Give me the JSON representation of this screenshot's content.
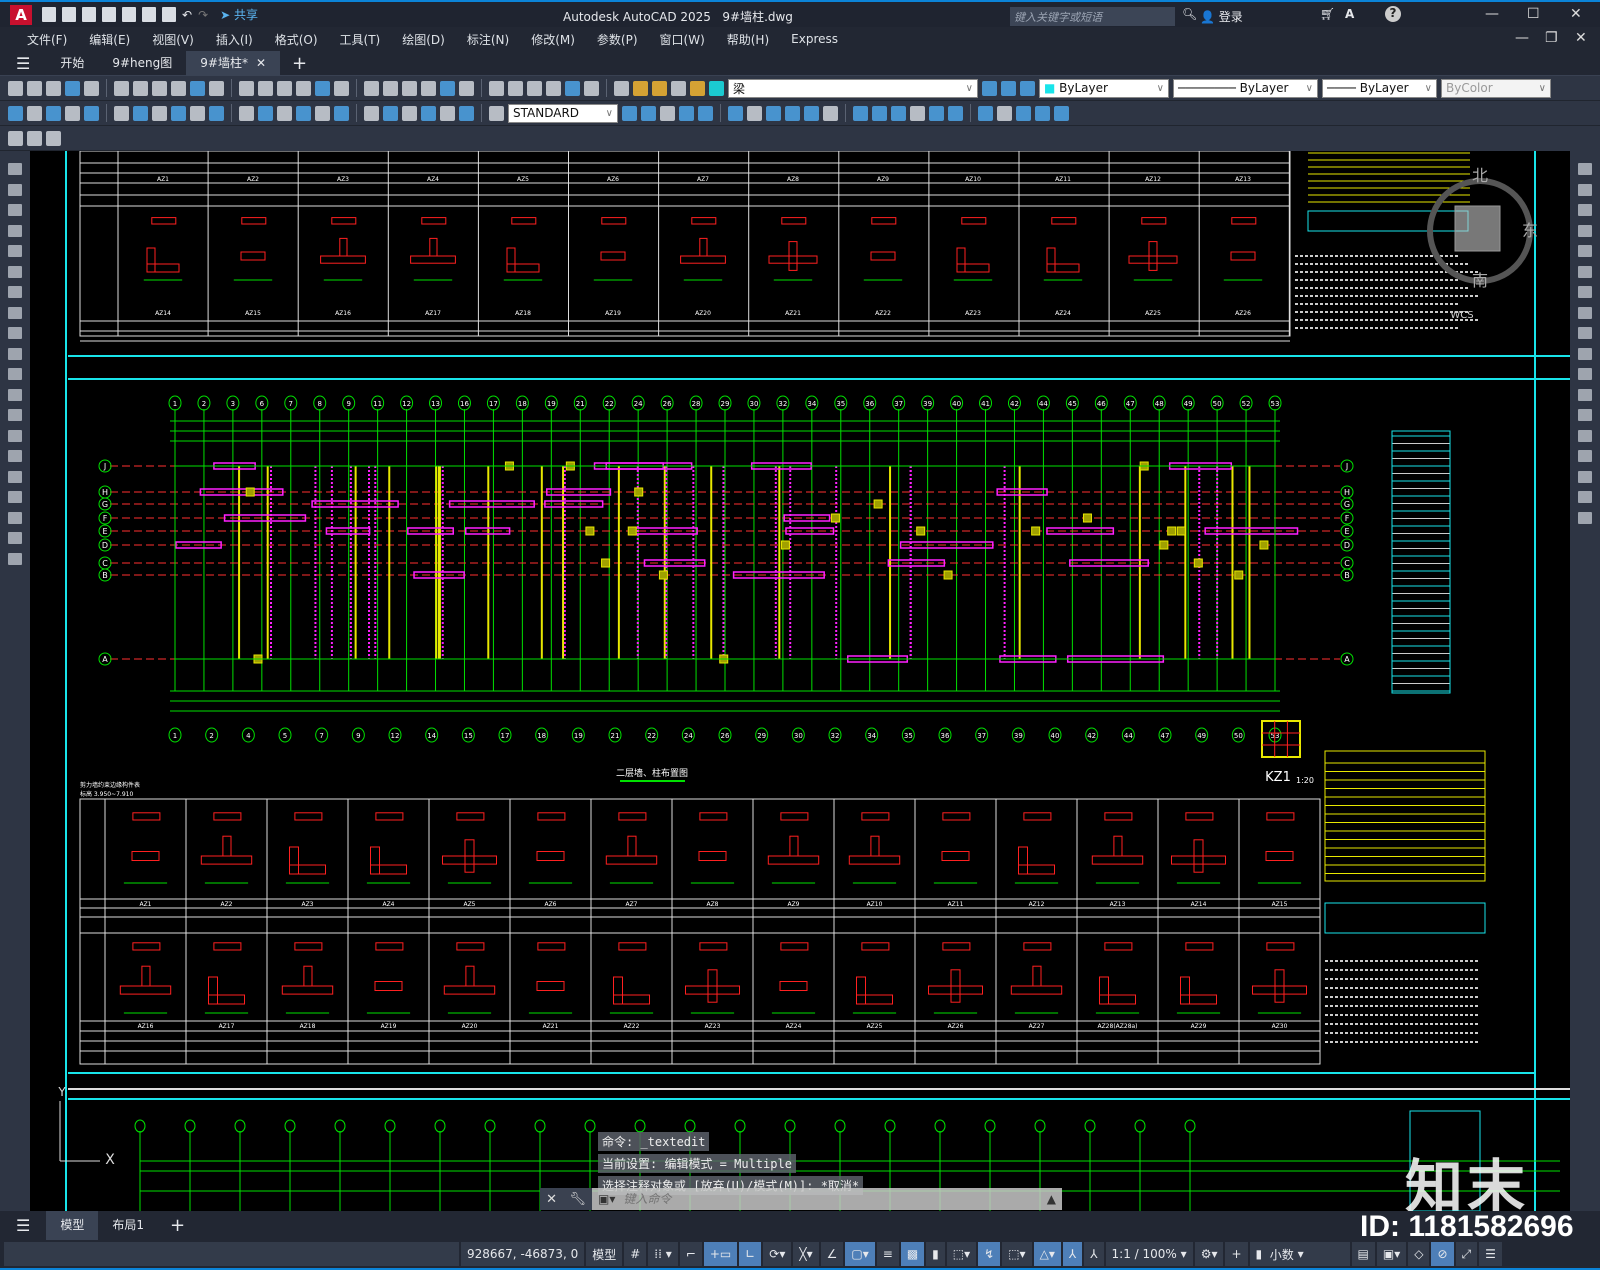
{
  "app": {
    "title": "Autodesk AutoCAD 2025",
    "file": "9#墙柱.dwg",
    "share": "共享",
    "logo": "A",
    "search_placeholder": "键入关键字或短语",
    "login": "登录"
  },
  "menu": [
    "文件(F)",
    "编辑(E)",
    "视图(V)",
    "插入(I)",
    "格式(O)",
    "工具(T)",
    "绘图(D)",
    "标注(N)",
    "修改(M)",
    "参数(P)",
    "窗口(W)",
    "帮助(H)",
    "Express"
  ],
  "file_tabs": [
    {
      "label": "开始",
      "active": false
    },
    {
      "label": "9#heng图",
      "active": false
    },
    {
      "label": "9#墙柱*",
      "active": true
    }
  ],
  "toolbar": {
    "layer": "梁",
    "color": "ByLayer",
    "linetype": "ByLayer",
    "lineweight": "ByLayer",
    "plotstyle": "ByColor",
    "dimstyle": "STANDARD"
  },
  "drawing": {
    "plan_title": "二层墙、柱布置图",
    "detail_label": "KZ1",
    "detail_scale": "1:20",
    "top_axes": [
      "1",
      "2",
      "3",
      "6",
      "7",
      "8",
      "9",
      "11",
      "12",
      "13",
      "16",
      "17",
      "18",
      "19",
      "21",
      "22",
      "24",
      "26",
      "28",
      "29",
      "30",
      "32",
      "34",
      "35",
      "36",
      "37",
      "39",
      "40",
      "41",
      "42",
      "44",
      "45",
      "46",
      "47",
      "48",
      "49",
      "50",
      "52",
      "53"
    ],
    "bottom_axes": [
      "1",
      "2",
      "4",
      "5",
      "7",
      "9",
      "12",
      "14",
      "15",
      "17",
      "18",
      "19",
      "21",
      "22",
      "24",
      "26",
      "29",
      "30",
      "32",
      "34",
      "35",
      "36",
      "37",
      "39",
      "40",
      "42",
      "44",
      "47",
      "49",
      "50",
      "53"
    ],
    "rows": [
      "J",
      "H",
      "G",
      "F",
      "E",
      "D",
      "C",
      "B",
      "A"
    ],
    "table_top_row1": [
      "AZ1",
      "AZ2",
      "AZ3",
      "AZ4",
      "AZ5",
      "AZ6",
      "AZ7",
      "AZ8",
      "AZ9",
      "AZ10",
      "AZ11",
      "AZ12",
      "AZ13"
    ],
    "table_top_row2": [
      "AZ14",
      "AZ15",
      "AZ16",
      "AZ17",
      "AZ18",
      "AZ19",
      "AZ20",
      "AZ21",
      "AZ22",
      "AZ23",
      "AZ24",
      "AZ25",
      "AZ26"
    ],
    "table_low_row1": [
      "AZ1",
      "AZ2",
      "AZ3",
      "AZ4",
      "AZ5",
      "AZ6",
      "AZ7",
      "AZ8",
      "AZ9",
      "AZ10",
      "AZ11",
      "AZ12",
      "AZ13",
      "AZ14",
      "AZ15"
    ],
    "table_low_row2": [
      "AZ16",
      "AZ17",
      "AZ18",
      "AZ19",
      "AZ20",
      "AZ21",
      "AZ22",
      "AZ23",
      "AZ24",
      "AZ25",
      "AZ26",
      "AZ27",
      "AZ28(AZ28a)",
      "AZ29",
      "AZ30"
    ],
    "table_header": "剪力墙约束边缘构件表",
    "table_range": "标高 3.950~7.910",
    "compass": {
      "north": "北",
      "east": "东",
      "south": "南",
      "wcs": "WCS"
    },
    "colors": {
      "wall": "#ff2020",
      "axis": "#00e000",
      "frame": "#18e4ea",
      "column": "#e8e800",
      "beam": "#ff20ff"
    }
  },
  "command": {
    "history": [
      "命令: _textedit",
      "当前设置: 编辑模式 = Multiple",
      "选择注释对象或 [放弃(U)/模式(M)]: *取消*"
    ],
    "placeholder": "键入命令"
  },
  "layout_tabs": [
    {
      "label": "模型",
      "active": true
    },
    {
      "label": "布局1",
      "active": false
    }
  ],
  "status": {
    "coords": "928667, -46873, 0",
    "space": "模型",
    "scale": "1:1 / 100%",
    "units": "小数"
  },
  "watermark": {
    "brand": "知末",
    "id": "ID: 1181582696"
  }
}
